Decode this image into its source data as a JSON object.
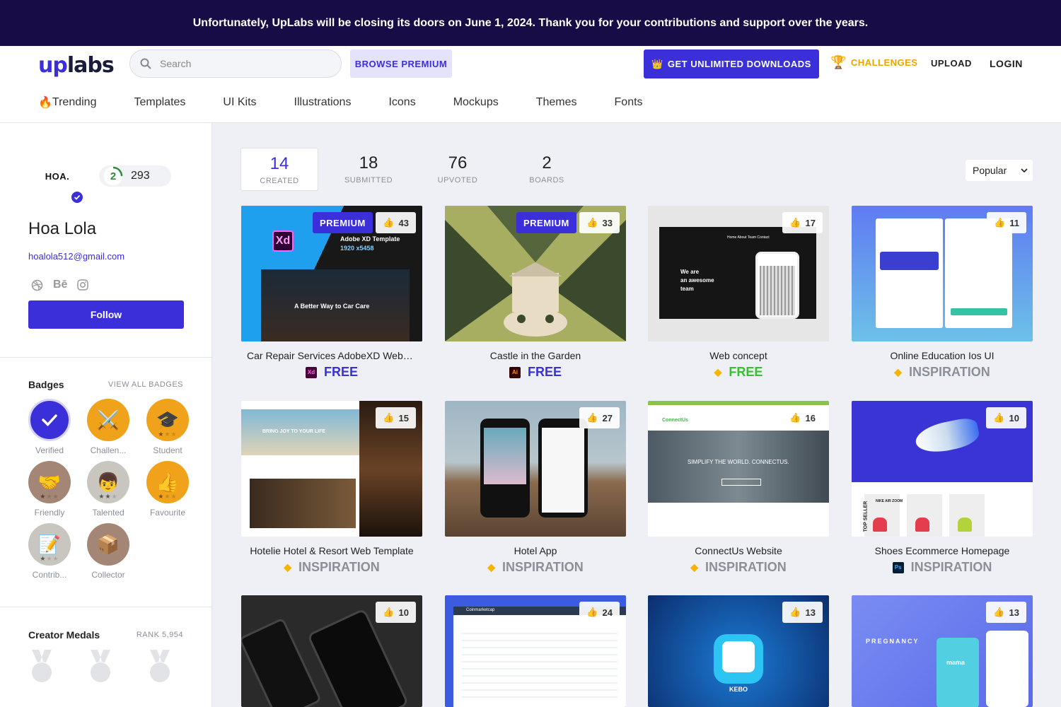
{
  "banner": {
    "text": "Unfortunately, UpLabs will be closing its doors on June 1, 2024. Thank you for your contributions and support over the years."
  },
  "header": {
    "logo_up": "up",
    "logo_labs": "labs",
    "search_placeholder": "Search",
    "browse_premium": "BROWSE PREMIUM",
    "get_unlimited": "GET UNLIMITED DOWNLOADS",
    "challenges": "CHALLENGES",
    "upload": "UPLOAD",
    "login": "LOGIN"
  },
  "nav": [
    {
      "label": "Trending"
    },
    {
      "label": "Templates"
    },
    {
      "label": "UI Kits"
    },
    {
      "label": "Illustrations"
    },
    {
      "label": "Icons"
    },
    {
      "label": "Mockups"
    },
    {
      "label": "Themes"
    },
    {
      "label": "Fonts"
    }
  ],
  "profile": {
    "avatar_text": "HOA.",
    "level": "2",
    "level_progress": 0.25,
    "points": "293",
    "name": "Hoa Lola",
    "email": "hoalola512@gmail.com",
    "behance_label": "Bē",
    "follow": "Follow"
  },
  "badges": {
    "title": "Badges",
    "view_all": "VIEW ALL BADGES",
    "items": [
      {
        "label": "Verified",
        "icon": "check-icon",
        "color": "#3b2fd9"
      },
      {
        "label": "Challen...",
        "icon": "challenger-icon",
        "color": "#f0a21b"
      },
      {
        "label": "Student",
        "icon": "graduation-cap-icon",
        "color": "#f0a21b"
      },
      {
        "label": "Friendly",
        "icon": "handshake-icon",
        "color": "#a48676"
      },
      {
        "label": "Talented",
        "icon": "person-icon",
        "color": "#c9c6bf"
      },
      {
        "label": "Favourite",
        "icon": "thumbs-up-icon",
        "color": "#f0a21b"
      },
      {
        "label": "Contrib...",
        "icon": "notepad-icon",
        "color": "#c9c6bf"
      },
      {
        "label": "Collector",
        "icon": "box-icon",
        "color": "#a48676"
      }
    ]
  },
  "medals": {
    "title": "Creator Medals",
    "rank": "RANK 5,954"
  },
  "stats": [
    {
      "num": "14",
      "label": "CREATED"
    },
    {
      "num": "18",
      "label": "SUBMITTED"
    },
    {
      "num": "76",
      "label": "UPVOTED"
    },
    {
      "num": "2",
      "label": "BOARDS"
    }
  ],
  "sort": {
    "value": "Popular"
  },
  "cards": [
    {
      "title": "Car Repair Services AdobeXD Websi...",
      "likes": "43",
      "premium": "PREMIUM",
      "price": "FREE",
      "tool": "xd-icon"
    },
    {
      "title": "Castle in the Garden",
      "likes": "33",
      "premium": "PREMIUM",
      "price": "FREE",
      "tool": "ai-icon"
    },
    {
      "title": "Web concept",
      "likes": "17",
      "price": "FREE",
      "tool": "sketch-icon"
    },
    {
      "title": "Online Education Ios UI",
      "likes": "11",
      "price": "INSPIRATION",
      "tool": "sketch-icon"
    },
    {
      "title": "Hotelie Hotel & Resort Web Template",
      "likes": "15",
      "price": "INSPIRATION",
      "tool": "sketch-icon"
    },
    {
      "title": "Hotel App",
      "likes": "27",
      "price": "INSPIRATION",
      "tool": "sketch-icon"
    },
    {
      "title": "ConnectUs Website",
      "likes": "16",
      "price": "INSPIRATION",
      "tool": "sketch-icon"
    },
    {
      "title": "Shoes Ecommerce Homepage",
      "likes": "10",
      "price": "INSPIRATION",
      "tool": "ps-icon"
    },
    {
      "title": "",
      "likes": "10"
    },
    {
      "title": "",
      "likes": "24"
    },
    {
      "title": "",
      "likes": "13"
    },
    {
      "title": "",
      "likes": "13"
    }
  ],
  "card_texts": {
    "xd_logo": "Xd",
    "adobe_xd_template": "Adobe XD Template",
    "xd_size": "1920 x5458",
    "car_care": "A Better Way to Car Care",
    "we_are": "We are",
    "an_awesome": "an awesome",
    "team": "team",
    "web_nav": "Home   About   Team   Contact",
    "hotel_hero": "BRING JOY TO YOUR LIFE",
    "connectus_logo": "ConnectUs",
    "connectus_hero": "SIMPLIFY THE WORLD. CONNECTUS.",
    "shoe_label": "NIKE AIR ZOOM",
    "top_seller": "TOP SELLER",
    "coinmarketcap": "Coinmarketcap",
    "kebo": "KEBO",
    "pregnancy": "PREGNANCY",
    "mama": "mama"
  },
  "colors": {
    "accent": "#3b2fd9",
    "banner": "#170c45",
    "challenges": "#e7a700",
    "free_green": "#34c22f"
  }
}
